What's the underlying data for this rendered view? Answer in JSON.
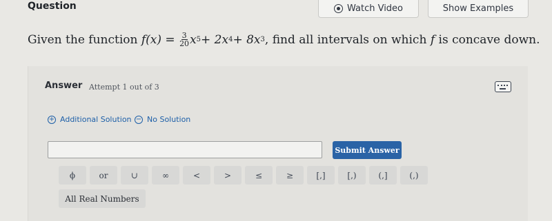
{
  "header": {
    "question_label": "Question",
    "watch_video": "Watch Video",
    "show_examples": "Show Examples"
  },
  "prompt": {
    "lead": "Given the function",
    "func": "f(x) =",
    "frac_num": "3",
    "frac_den": "20",
    "t1": "x",
    "t1_exp": "5",
    "t2": " + 2x",
    "t2_exp": "4",
    "t3": " + 8x",
    "t3_exp": "3",
    "tail": ", find all intervals on which",
    "f": "f",
    "end": "is concave down."
  },
  "answer": {
    "title": "Answer",
    "attempt": "Attempt 1 out of 3",
    "additional_solution": "Additional Solution",
    "no_solution": "No Solution",
    "input_value": "",
    "submit": "Submit Answer",
    "keys": [
      "ϕ",
      "or",
      "∪",
      "∞",
      "<",
      ">",
      "≤",
      "≥",
      "[,]",
      "[,)",
      "(,]",
      "(,)"
    ],
    "all_real": "All Real Numbers"
  },
  "colors": {
    "accent": "#2a63a6",
    "link": "#1d5fa8",
    "background": "#e9e8e4"
  }
}
